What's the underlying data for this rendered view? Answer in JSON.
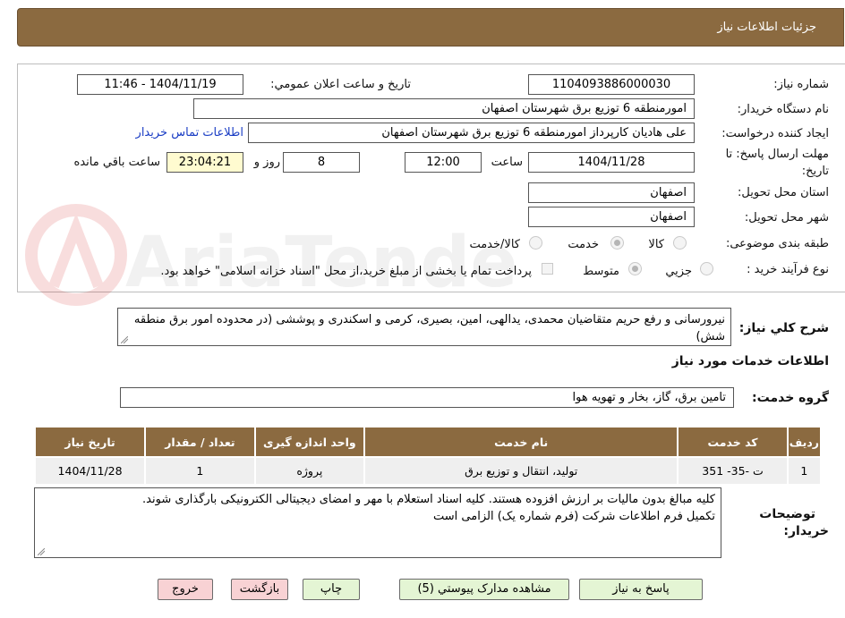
{
  "header": {
    "title": "جزئیات اطلاعات نیاز"
  },
  "form": {
    "need_number_label": "شماره نیاز:",
    "need_number": "1104093886000030",
    "announce_label": "تاریخ و ساعت اعلان عمومي:",
    "announce_value": "1404/11/19 - 11:46",
    "buyer_org_label": "نام دستگاه خريدار:",
    "buyer_org": "امورمنطقه 6 توزیع برق شهرستان اصفهان",
    "requester_label": "ایجاد کننده درخواست:",
    "requester": "علی هادیان کارپرداز امورمنطقه 6 توزیع برق شهرستان اصفهان",
    "contact_link": "اطلاعات تماس خريدار",
    "deadline_label_1": "مهلت ارسال پاسخ: تا",
    "deadline_label_2": "تاريخ:",
    "deadline_date": "1404/11/28",
    "time_label": "ساعت",
    "deadline_time": "12:00",
    "days_value": "8",
    "days_label": "روز و",
    "remaining_time": "23:04:21",
    "remaining_label": "ساعت باقي مانده",
    "province_label": "استان محل تحويل:",
    "province": "اصفهان",
    "city_label": "شهر محل تحويل:",
    "city": "اصفهان",
    "category_label": "طبقه بندی موضوعی:",
    "category_options": [
      "کالا",
      "خدمت",
      "کالا/خدمت"
    ],
    "process_label": "نوع فرآيند خريد :",
    "process_options": [
      "جزيي",
      "متوسط"
    ],
    "payment_note": "پرداخت تمام یا بخشی از مبلغ خرید،از محل \"اسناد خزانه اسلامی\" خواهد بود."
  },
  "description": {
    "label": "شرح کلي نياز:",
    "text": "نیرورسانی و رفع حریم متقاضیان محمدی، یدالهی، امین، بصیری، کرمی و اسکندری و پوششی  (در محدوده امور برق منطقه شش)"
  },
  "services": {
    "section_title": "اطلاعات خدمات مورد نياز",
    "group_label": "گروه خدمت:",
    "group_value": "تامین برق، گاز، بخار و تهویه هوا",
    "columns": [
      "رديف",
      "کد خدمت",
      "نام خدمت",
      "واحد اندازه گيری",
      "تعداد / مقدار",
      "تاريخ نياز"
    ],
    "rows": [
      [
        "1",
        "ت -35- 351",
        "تولید، انتقال و توزیع برق",
        "پروژه",
        "1",
        "1404/11/28"
      ]
    ]
  },
  "buyer_notes": {
    "label_1": "توضيحات",
    "label_2": "خريدار:",
    "line_1": "کلیه مبالغ بدون مالیات بر ارزش افزوده هستند. کلیه اسناد استعلام با مهر و امضای دیجیتالی الکترونیکی بارگذاری شوند.",
    "line_2": "تکمیل فرم اطلاعات شرکت (فرم شماره یک) الزامی است"
  },
  "buttons": {
    "reply": "پاسخ به نياز",
    "attachments": "مشاهده مدارک پيوستي (5)",
    "print": "چاپ",
    "back": "بازگشت",
    "exit": "خروج"
  },
  "watermark": "AriaTender.neT",
  "colors": {
    "header_brown": "#8b6a40",
    "button_green": "#e4f5d4",
    "button_pink": "#f8d2d4",
    "link_blue": "#1a3dc4"
  }
}
